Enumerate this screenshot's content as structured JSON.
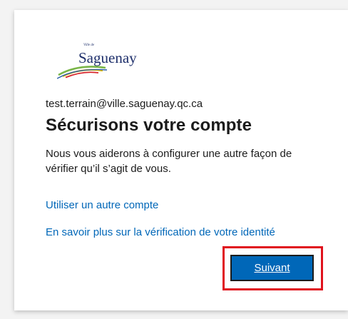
{
  "brand": {
    "logo_name": "Saguenay",
    "logo_small": "Ville de",
    "colors": {
      "text": "#1e2f6b",
      "swoosh_green": "#7ab648",
      "swoosh_yellow": "#f2c100",
      "swoosh_red": "#d9262b",
      "swoosh_blue": "#2a5fa8"
    }
  },
  "account": {
    "email": "test.terrain@ville.saguenay.qc.ca"
  },
  "main": {
    "title": "Sécurisons votre compte",
    "description": "Nous vous aiderons à configurer une autre façon de vérifier qu’il s’agit de vous."
  },
  "links": {
    "other_account": "Utiliser un autre compte",
    "learn_more": "En savoir plus sur la vérification de votre identité"
  },
  "actions": {
    "next_label": "Suivant"
  },
  "theme": {
    "link_color": "#0067b8",
    "button_color": "#0067b8",
    "highlight_color": "#e0121d"
  }
}
